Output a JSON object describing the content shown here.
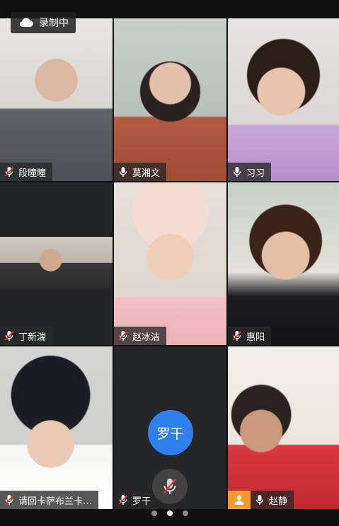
{
  "recording": {
    "label": "录制中"
  },
  "participants": [
    {
      "name": "段瞳瞳",
      "mic": "muted"
    },
    {
      "name": "莫湘文",
      "mic": "on"
    },
    {
      "name": "习习",
      "mic": "on"
    },
    {
      "name": "丁新湍",
      "mic": "muted"
    },
    {
      "name": "赵冰洁",
      "mic": "muted"
    },
    {
      "name": "惠阳",
      "mic": "muted"
    },
    {
      "name": "请回卡萨布兰卡…",
      "mic": "muted"
    },
    {
      "name": "罗干",
      "mic": "muted",
      "avatar_text": "罗干"
    },
    {
      "name": "赵静",
      "mic": "on",
      "host": true
    }
  ],
  "pager": {
    "pages": 3,
    "current": 2
  },
  "colors": {
    "avatar": "#2f80ed",
    "host_badge": "#f59a2b",
    "muted_slash": "#e53935"
  },
  "icons": {
    "recording": "cloud-icon",
    "mic_on": "mic-icon",
    "mic_muted": "mic-muted-icon",
    "host": "person-icon"
  }
}
